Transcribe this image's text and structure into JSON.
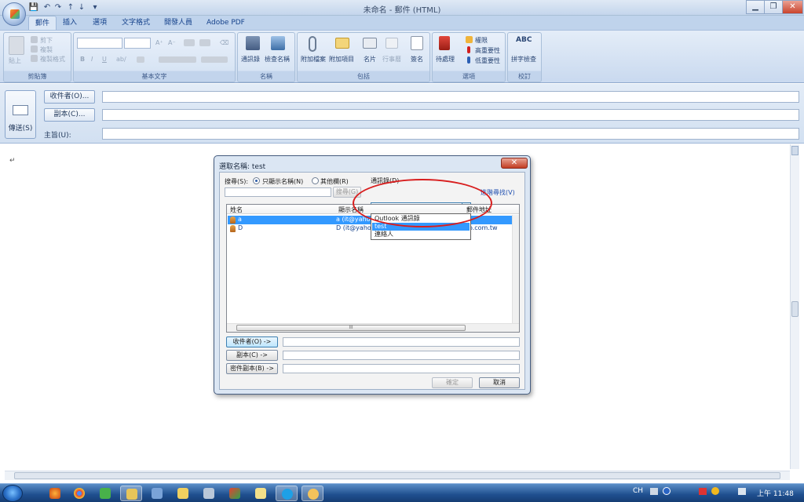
{
  "window": {
    "title": "未命名 - 郵件 (HTML)",
    "minimize": "▁",
    "restore": "❐",
    "close": "✕"
  },
  "qat": {
    "save": "💾",
    "undo": "↶",
    "redo": "↷",
    "up": "↑",
    "down": "↓",
    "more": "▾"
  },
  "tabs": [
    {
      "label": "郵件"
    },
    {
      "label": "插入"
    },
    {
      "label": "選項"
    },
    {
      "label": "文字格式"
    },
    {
      "label": "開發人員"
    },
    {
      "label": "Adobe PDF"
    }
  ],
  "ribbon": {
    "clipboard": {
      "label": "剪貼簿",
      "paste": "貼上",
      "cut": "剪下",
      "copy": "複製",
      "format_painter": "複製格式"
    },
    "basic_text": {
      "label": "基本文字",
      "bold": "B",
      "italic": "I",
      "underline": "U",
      "strike": "ab∕",
      "font_grow": "A⁺",
      "font_shrink": "A⁻",
      "clear": "⌫"
    },
    "names": {
      "label": "名稱",
      "address_book": "通訊錄",
      "check_names": "檢查名稱"
    },
    "include": {
      "label": "包括",
      "attach_file": "附加檔案",
      "attach_item": "附加項目",
      "business_card": "名片",
      "calendar": "行事曆",
      "signature": "簽名"
    },
    "options": {
      "label": "選項",
      "follow_up": "待處理",
      "permission": "權限",
      "high_importance": "高重要性",
      "low_importance": "低重要性"
    },
    "proofing": {
      "label": "校訂",
      "abc": "ABC",
      "spelling": "拼字檢查"
    }
  },
  "header": {
    "send": "傳送(S)",
    "to": "收件者(O)...",
    "cc": "副本(C)...",
    "subject": "主旨(U):"
  },
  "body": {
    "pilcrow": "↵"
  },
  "dialog": {
    "title": "選取名稱: test",
    "close": "✕",
    "search_label": "搜尋(S):",
    "name_only": "只顯示名稱(N)",
    "more_columns": "其他欄(R)",
    "address_book_label": "通訊錄(D)",
    "go_button": "搜尋(G)",
    "combo_value": "test",
    "advanced_find": "進階尋找(V)",
    "dropdown_items": [
      {
        "label": "Outlook 通訊錄"
      },
      {
        "label": "test"
      },
      {
        "label": "連絡人"
      }
    ],
    "columns": {
      "name": "姓名",
      "display": "顯示名稱",
      "email": "郵件地址"
    },
    "rows": [
      {
        "name": "a",
        "display": "a (it@yahoo.",
        "email": ""
      },
      {
        "name": "D",
        "display": "D (it@yahoo.com.tw)",
        "email": "it@yahoo.com.tw"
      }
    ],
    "to_button": "收件者(O) ->",
    "cc_button": "副本(C) ->",
    "bcc_button": "密件副本(B) ->",
    "ok": "確定",
    "cancel": "取消",
    "hscroll_grip": "III"
  },
  "taskbar": {
    "lang": "CH",
    "clock": "上午 11:48"
  }
}
